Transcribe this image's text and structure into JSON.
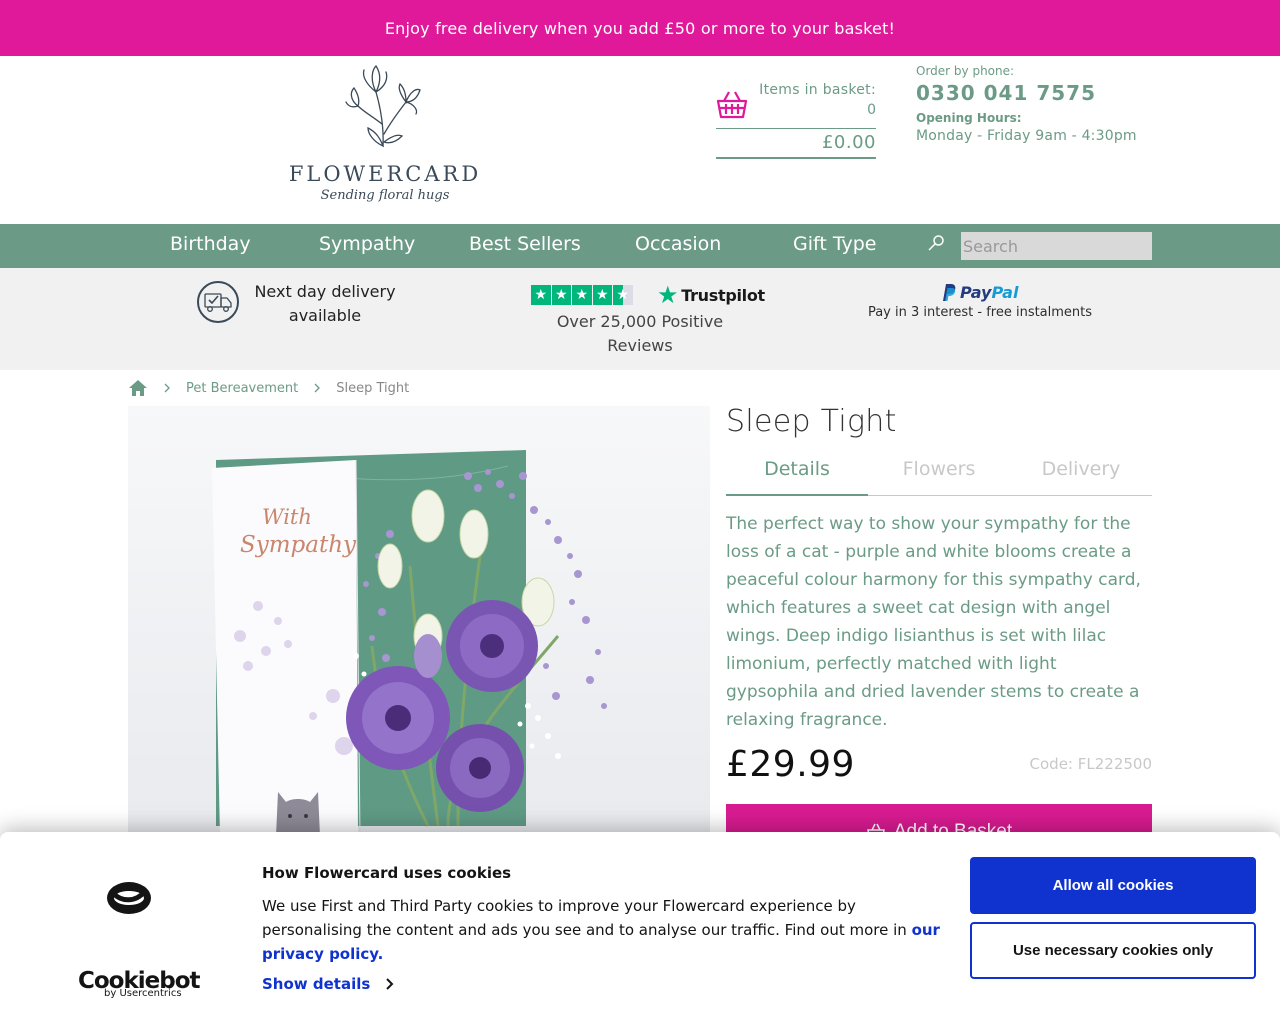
{
  "promo": {
    "text": "Enjoy free delivery when you add £50 or more to your basket!"
  },
  "logo": {
    "wordmark": "FLOWERCARD",
    "tagline": "Sending floral hugs"
  },
  "basket": {
    "label": "Items in basket:",
    "count": "0",
    "total": "£0.00"
  },
  "contact": {
    "order_label": "Order by phone:",
    "phone": "0330 041 7575",
    "hours_label": "Opening Hours:",
    "hours": "Monday - Friday 9am - 4:30pm"
  },
  "nav": {
    "items": [
      "Birthday",
      "Sympathy",
      "Best Sellers",
      "Occasion",
      "Gift Type"
    ],
    "search_placeholder": "Search"
  },
  "usp": {
    "delivery": "Next day delivery available",
    "trustpilot_brand": "Trustpilot",
    "trustpilot_text": "Over 25,000 Positive Reviews",
    "paypal_brand_a": "Pay",
    "paypal_brand_b": "Pal",
    "paypal_text": "Pay in 3 interest - free instalments",
    "rating_stars": 4.5
  },
  "breadcrumb": {
    "items": [
      "Pet Bereavement",
      "Sleep Tight"
    ]
  },
  "product": {
    "title": "Sleep Tight",
    "tabs": [
      "Details",
      "Flowers",
      "Delivery"
    ],
    "active_tab": "Details",
    "description": "The perfect way to show your sympathy for the loss of a cat - purple and white blooms create a peaceful colour harmony for this sympathy card, which features a sweet cat design with angel wings. Deep indigo lisianthus is set with lilac limonium, perfectly matched with light gypsophila and dried lavender stems to create a relaxing fragrance.",
    "price": "£29.99",
    "code": "Code: FL222500",
    "add_label": "Add to Basket",
    "card_text": "With Sympathy"
  },
  "cookie": {
    "brand": "Cookiebot",
    "brand_by": "by Usercentrics",
    "title": "How Flowercard uses cookies",
    "body": "We use First and Third Party cookies to improve your Flowercard experience by personalising the content and ads you see and to analyse our traffic. Find out more in ",
    "link": "our privacy policy.",
    "show_details": "Show details",
    "allow_all": "Allow all cookies",
    "necessary_only": "Use necessary cookies only"
  },
  "colors": {
    "brand_pink": "#e0199a",
    "brand_green": "#6b9b86",
    "cookie_blue": "#1032cf",
    "trustpilot_green": "#00b67a"
  }
}
